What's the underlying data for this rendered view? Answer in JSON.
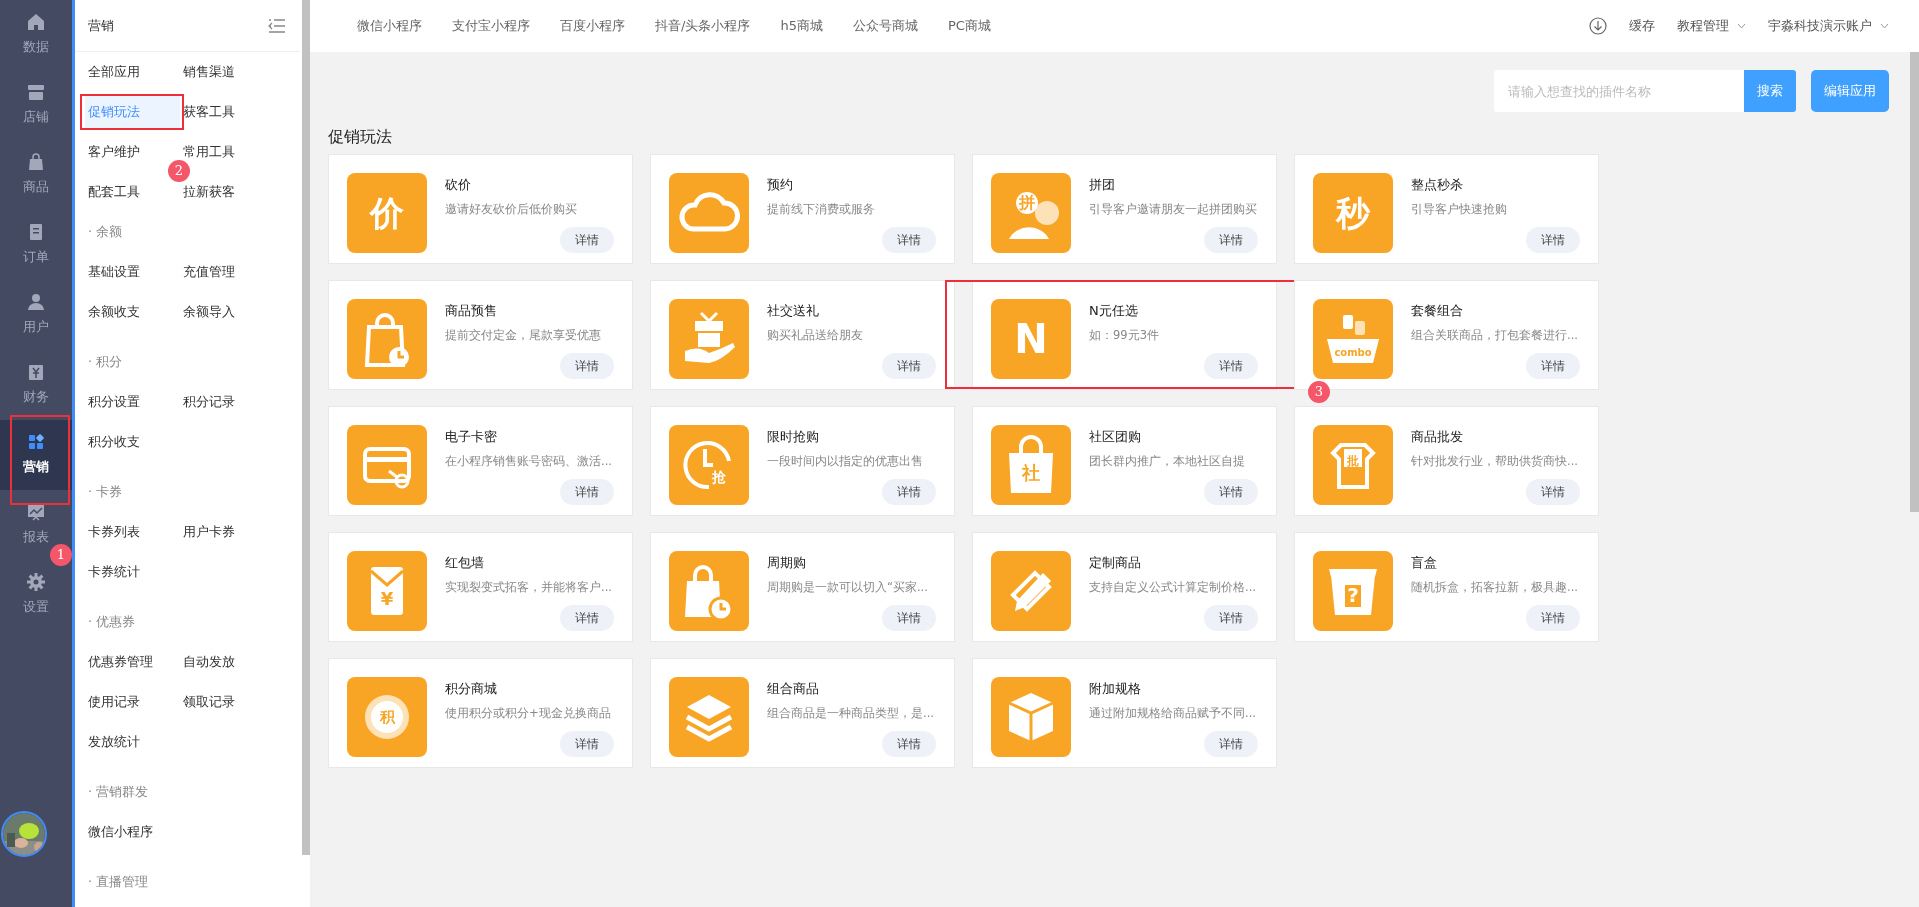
{
  "rail": {
    "items": [
      {
        "label": "数据",
        "selected": false
      },
      {
        "label": "店铺",
        "selected": false
      },
      {
        "label": "商品",
        "selected": false
      },
      {
        "label": "订单",
        "selected": false
      },
      {
        "label": "用户",
        "selected": false
      },
      {
        "label": "财务",
        "selected": false
      },
      {
        "label": "营销",
        "selected": true,
        "callout": "1"
      },
      {
        "label": "报表",
        "selected": false
      },
      {
        "label": "设置",
        "selected": false
      }
    ]
  },
  "sidebar": {
    "title": "营销",
    "groups": [
      {
        "items": [
          {
            "label": "全部应用",
            "selected": false
          },
          {
            "label": "销售渠道",
            "selected": false
          },
          {
            "label": "促销玩法",
            "selected": true,
            "callout": "2"
          },
          {
            "label": "获客工具",
            "selected": false
          },
          {
            "label": "客户维护",
            "selected": false
          },
          {
            "label": "常用工具",
            "selected": false
          },
          {
            "label": "配套工具",
            "selected": false
          },
          {
            "label": "拉新获客",
            "selected": false
          }
        ]
      },
      {
        "title": "· 余额",
        "items": [
          {
            "label": "基础设置",
            "selected": false
          },
          {
            "label": "充值管理",
            "selected": false
          },
          {
            "label": "余额收支",
            "selected": false
          },
          {
            "label": "余额导入",
            "selected": false
          }
        ]
      },
      {
        "title": "· 积分",
        "items": [
          {
            "label": "积分设置",
            "selected": false
          },
          {
            "label": "积分记录",
            "selected": false
          },
          {
            "label": "积分收支",
            "selected": false
          }
        ]
      },
      {
        "title": "· 卡券",
        "items": [
          {
            "label": "卡券列表",
            "selected": false
          },
          {
            "label": "用户卡券",
            "selected": false
          },
          {
            "label": "卡券统计",
            "selected": false
          }
        ]
      },
      {
        "title": "· 优惠券",
        "items": [
          {
            "label": "优惠券管理",
            "selected": false
          },
          {
            "label": "自动发放",
            "selected": false
          },
          {
            "label": "使用记录",
            "selected": false
          },
          {
            "label": "领取记录",
            "selected": false
          },
          {
            "label": "发放统计",
            "selected": false
          }
        ]
      },
      {
        "title": "· 营销群发",
        "items": [
          {
            "label": "微信小程序",
            "selected": false
          }
        ]
      },
      {
        "title": "· 直播管理"
      }
    ]
  },
  "top_nav": {
    "links": [
      "微信小程序",
      "支付宝小程序",
      "百度小程序",
      "抖音/头条小程序",
      "h5商城",
      "公众号商城",
      "PC商城"
    ],
    "cache": "缓存",
    "tutorial": "教程管理",
    "account": "宇淼科技演示账户"
  },
  "search": {
    "placeholder": "请输入想查找的插件名称",
    "button": "搜索"
  },
  "edit_button": "编辑应用",
  "section_title": "促销玩法",
  "cards": [
    {
      "title": "砍价",
      "description": "邀请好友砍价后低价购买",
      "button": "详情",
      "icon_text": "价"
    },
    {
      "title": "预约",
      "description": "提前线下消费或服务",
      "button": "详情"
    },
    {
      "title": "拼团",
      "description": "引导客户邀请朋友一起拼团购买",
      "button": "详情",
      "icon_text": "拼"
    },
    {
      "title": "整点秒杀",
      "description": "引导客户快速抢购",
      "button": "详情",
      "icon_text": "秒"
    },
    {
      "title": "商品预售",
      "description": "提前交付定金，尾款享受优惠",
      "button": "详情"
    },
    {
      "title": "社交送礼",
      "description": "购买礼品送给朋友",
      "button": "详情"
    },
    {
      "title": "N元任选",
      "description": "如：99元3件",
      "button": "详情",
      "icon_text": "N",
      "callout": "3"
    },
    {
      "title": "套餐组合",
      "description": "组合关联商品，打包套餐进行...",
      "button": "详情",
      "icon_text": "combo"
    },
    {
      "title": "电子卡密",
      "description": "在小程序销售账号密码、激活...",
      "button": "详情"
    },
    {
      "title": "限时抢购",
      "description": "一段时间内以指定的优惠出售",
      "button": "详情",
      "icon_text": "抢"
    },
    {
      "title": "社区团购",
      "description": "团长群内推广，本地社区自提",
      "button": "详情",
      "icon_text": "社"
    },
    {
      "title": "商品批发",
      "description": "针对批发行业，帮助供货商快...",
      "button": "详情",
      "icon_text": "批"
    },
    {
      "title": "红包墙",
      "description": "实现裂变式拓客，并能将客户...",
      "button": "详情",
      "icon_text": "¥"
    },
    {
      "title": "周期购",
      "description": "周期购是一款可以切入“买家...",
      "button": "详情"
    },
    {
      "title": "定制商品",
      "description": "支持自定义公式计算定制价格...",
      "button": "详情"
    },
    {
      "title": "盲盒",
      "description": "随机拆盒，拓客拉新，极具趣...",
      "button": "详情",
      "icon_text": "?"
    },
    {
      "title": "积分商城",
      "description": "使用积分或积分+现金兑换商品",
      "button": "详情",
      "icon_text": "积"
    },
    {
      "title": "组合商品",
      "description": "组合商品是一种商品类型，是...",
      "button": "详情"
    },
    {
      "title": "附加规格",
      "description": "通过附加规格给商品赋予不同...",
      "button": "详情"
    }
  ]
}
